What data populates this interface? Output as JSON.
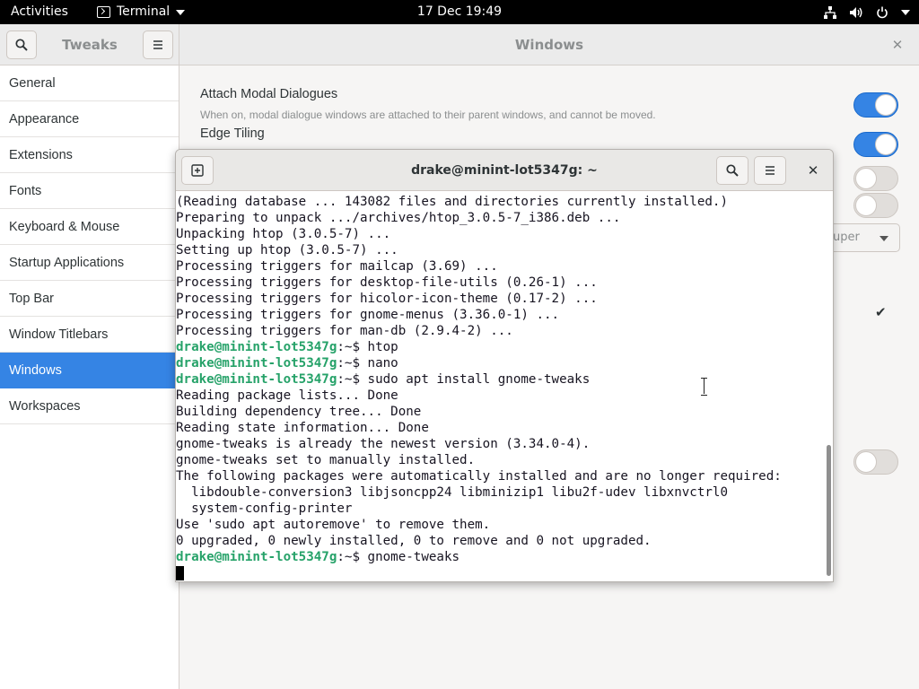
{
  "topbar": {
    "activities": "Activities",
    "app_name": "Terminal",
    "clock": "17 Dec  19:49",
    "status_icons": [
      "network-icon",
      "volume-icon",
      "power-icon"
    ]
  },
  "tweaks": {
    "title": "Tweaks",
    "panel_title": "Windows",
    "sidebar": [
      {
        "label": "General",
        "active": false
      },
      {
        "label": "Appearance",
        "active": false
      },
      {
        "label": "Extensions",
        "active": false
      },
      {
        "label": "Fonts",
        "active": false
      },
      {
        "label": "Keyboard & Mouse",
        "active": false
      },
      {
        "label": "Startup Applications",
        "active": false
      },
      {
        "label": "Top Bar",
        "active": false
      },
      {
        "label": "Window Titlebars",
        "active": false
      },
      {
        "label": "Windows",
        "active": true
      },
      {
        "label": "Workspaces",
        "active": false
      }
    ],
    "settings": {
      "attach_modal": {
        "title": "Attach Modal Dialogues",
        "desc": "When on, modal dialogue windows are attached to their parent windows, and cannot be moved.",
        "on": true
      },
      "edge_tiling": {
        "title": "Edge Tiling",
        "on": true
      },
      "switch_3": {
        "on": false
      },
      "switch_4": {
        "on": false
      },
      "switch_5": {
        "on": false
      }
    },
    "dropdown_visible_text": "uper",
    "accent_color": "#3584e4"
  },
  "terminal": {
    "title": "drake@minint-lot5347g: ~",
    "lines": [
      {
        "text": "(Reading database ... 143082 files and directories currently installed.)"
      },
      {
        "text": "Preparing to unpack .../archives/htop_3.0.5-7_i386.deb ..."
      },
      {
        "text": "Unpacking htop (3.0.5-7) ..."
      },
      {
        "text": "Setting up htop (3.0.5-7) ..."
      },
      {
        "text": "Processing triggers for mailcap (3.69) ..."
      },
      {
        "text": "Processing triggers for desktop-file-utils (0.26-1) ..."
      },
      {
        "text": "Processing triggers for hicolor-icon-theme (0.17-2) ..."
      },
      {
        "text": "Processing triggers for gnome-menus (3.36.0-1) ..."
      },
      {
        "text": "Processing triggers for man-db (2.9.4-2) ..."
      },
      {
        "prompt": "drake@minint-lot5347g",
        "text": ":~$ htop"
      },
      {
        "prompt": "drake@minint-lot5347g",
        "text": ":~$ nano"
      },
      {
        "prompt": "drake@minint-lot5347g",
        "text": ":~$ sudo apt install gnome-tweaks"
      },
      {
        "text": "Reading package lists... Done"
      },
      {
        "text": "Building dependency tree... Done"
      },
      {
        "text": "Reading state information... Done"
      },
      {
        "text": "gnome-tweaks is already the newest version (3.34.0-4)."
      },
      {
        "text": "gnome-tweaks set to manually installed."
      },
      {
        "text": "The following packages were automatically installed and are no longer required:"
      },
      {
        "text": "  libdouble-conversion3 libjsoncpp24 libminizip1 libu2f-udev libxnvctrl0"
      },
      {
        "text": "  system-config-printer"
      },
      {
        "text": "Use 'sudo apt autoremove' to remove them."
      },
      {
        "text": "0 upgraded, 0 newly installed, 0 to remove and 0 not upgraded."
      },
      {
        "prompt": "drake@minint-lot5347g",
        "text": ":~$ gnome-tweaks"
      },
      {
        "cursor": true,
        "text": ""
      }
    ],
    "prompt_color": "#26a269"
  }
}
